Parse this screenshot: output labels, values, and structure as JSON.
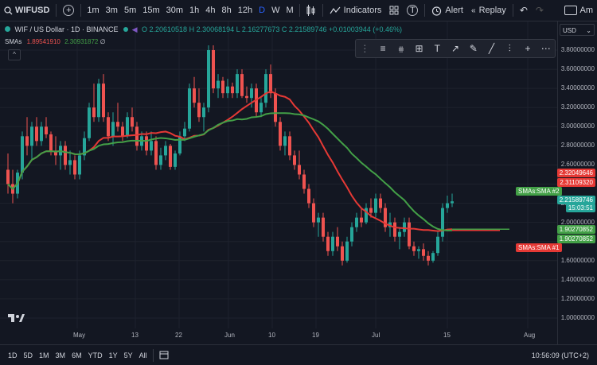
{
  "topbar": {
    "symbol": "WIFUSD",
    "add_symbol": "+",
    "timeframes": [
      "1m",
      "3m",
      "5m",
      "15m",
      "30m",
      "1h",
      "4h",
      "8h",
      "12h",
      "D",
      "W",
      "M"
    ],
    "active_timeframe": "D",
    "indicators_label": "Indicators",
    "alert_label": "Alert",
    "replay_label": "Replay",
    "right_label": "Am"
  },
  "legend": {
    "title": "WIF / US Dollar · 1D · BINANCE",
    "open": "O 2.20610518",
    "high": "H 2.30068194",
    "low": "L 2.16277673",
    "close": "C 2.21589746",
    "change": "+0.01003944 (+0.46%)",
    "sma_name": "SMAs",
    "sma_value1": "1.89541910",
    "sma_value2": "2.30931872",
    "sma_suffix": "∅"
  },
  "price_axis": {
    "currency": "USD",
    "ticks": [
      "3.80000000",
      "3.60000000",
      "3.40000000",
      "3.20000000",
      "3.00000000",
      "2.80000000",
      "2.60000000",
      "2.40000000",
      "2.20000000",
      "2.00000000",
      "1.80000000",
      "1.60000000",
      "1.40000000",
      "1.20000000",
      "1.00000000"
    ],
    "labels": {
      "sma2_top": "2.32049646",
      "sma2_bot": "2.31109320",
      "price": "2.21589746",
      "countdown": "15:03:51",
      "sma1_top": "1.90270852",
      "sma1_bot": "1.90270852"
    },
    "sma2_tag": "SMAs:SMA #2",
    "sma1_tag": "SMAs:SMA #1"
  },
  "time_axis": [
    "May",
    "13",
    "22",
    "Jun",
    "10",
    "19",
    "Jul",
    "15",
    "Aug"
  ],
  "bottombar": {
    "ranges": [
      "1D",
      "5D",
      "1M",
      "3M",
      "6M",
      "YTD",
      "1Y",
      "5Y",
      "All"
    ],
    "clock": "10:56:09 (UTC+2)"
  },
  "colors": {
    "up": "#26a69a",
    "down": "#ef5350",
    "sma_red": "#e53935",
    "sma_green": "#43a047",
    "accent": "#2962ff"
  },
  "chart_data": {
    "type": "candlestick",
    "ylim": [
      1.0,
      3.85
    ],
    "series": [
      {
        "name": "WIF",
        "ohlc": [
          [
            2.55,
            2.72,
            2.3,
            2.4
          ],
          [
            2.4,
            2.55,
            2.2,
            2.3
          ],
          [
            2.3,
            2.55,
            2.25,
            2.52
          ],
          [
            2.52,
            2.95,
            2.45,
            2.9
          ],
          [
            2.9,
            3.1,
            2.7,
            2.8
          ],
          [
            2.8,
            3.05,
            2.65,
            3.0
          ],
          [
            3.0,
            3.1,
            2.8,
            2.85
          ],
          [
            2.85,
            3.05,
            2.8,
            3.0
          ],
          [
            3.0,
            3.1,
            2.88,
            2.92
          ],
          [
            2.92,
            2.95,
            2.7,
            2.75
          ],
          [
            2.75,
            2.9,
            2.6,
            2.7
          ],
          [
            2.7,
            2.85,
            2.55,
            2.8
          ],
          [
            2.8,
            2.85,
            2.55,
            2.6
          ],
          [
            2.6,
            2.75,
            2.5,
            2.65
          ],
          [
            2.65,
            2.7,
            2.45,
            2.5
          ],
          [
            2.5,
            2.75,
            2.45,
            2.7
          ],
          [
            2.7,
            2.95,
            2.65,
            2.88
          ],
          [
            2.88,
            3.25,
            2.85,
            3.2
          ],
          [
            3.2,
            3.45,
            3.05,
            3.1
          ],
          [
            3.1,
            3.5,
            3.05,
            3.45
          ],
          [
            3.45,
            3.55,
            3.05,
            3.1
          ],
          [
            3.1,
            3.15,
            2.85,
            2.9
          ],
          [
            2.9,
            3.15,
            2.8,
            3.05
          ],
          [
            3.05,
            3.25,
            2.95,
            3.0
          ],
          [
            3.0,
            3.05,
            2.85,
            2.9
          ],
          [
            2.9,
            3.15,
            2.88,
            3.1
          ],
          [
            3.1,
            3.2,
            2.95,
            3.0
          ],
          [
            3.0,
            3.05,
            2.75,
            2.8
          ],
          [
            2.8,
            2.95,
            2.75,
            2.9
          ],
          [
            2.9,
            2.95,
            2.7,
            2.75
          ],
          [
            2.75,
            2.95,
            2.7,
            2.85
          ],
          [
            2.85,
            2.9,
            2.55,
            2.6
          ],
          [
            2.6,
            2.78,
            2.55,
            2.7
          ],
          [
            2.7,
            2.85,
            2.65,
            2.8
          ],
          [
            2.8,
            2.82,
            2.55,
            2.58
          ],
          [
            2.58,
            2.75,
            2.55,
            2.72
          ],
          [
            2.72,
            2.95,
            2.7,
            2.9
          ],
          [
            2.9,
            3.05,
            2.85,
            2.98
          ],
          [
            2.98,
            3.45,
            2.95,
            3.4
          ],
          [
            3.4,
            3.52,
            3.2,
            3.25
          ],
          [
            3.25,
            3.4,
            3.05,
            3.1
          ],
          [
            3.1,
            3.25,
            2.95,
            3.2
          ],
          [
            3.2,
            3.85,
            3.15,
            3.8
          ],
          [
            3.8,
            3.85,
            3.35,
            3.4
          ],
          [
            3.4,
            3.55,
            3.3,
            3.48
          ],
          [
            3.48,
            3.52,
            3.3,
            3.35
          ],
          [
            3.35,
            3.5,
            3.3,
            3.42
          ],
          [
            3.42,
            3.46,
            3.3,
            3.35
          ],
          [
            3.35,
            3.6,
            3.3,
            3.55
          ],
          [
            3.55,
            3.6,
            3.3,
            3.32
          ],
          [
            3.32,
            3.42,
            3.25,
            3.3
          ],
          [
            3.3,
            3.45,
            3.2,
            3.4
          ],
          [
            3.4,
            3.45,
            3.1,
            3.15
          ],
          [
            3.15,
            3.3,
            3.1,
            3.25
          ],
          [
            3.25,
            3.6,
            3.2,
            3.55
          ],
          [
            3.55,
            3.65,
            3.3,
            3.35
          ],
          [
            3.35,
            3.4,
            3.0,
            3.05
          ],
          [
            3.05,
            3.1,
            2.75,
            2.8
          ],
          [
            2.8,
            2.95,
            2.7,
            2.9
          ],
          [
            2.9,
            2.95,
            2.65,
            2.7
          ],
          [
            2.7,
            2.75,
            2.55,
            2.6
          ],
          [
            2.6,
            2.75,
            2.45,
            2.5
          ],
          [
            2.5,
            2.55,
            2.3,
            2.35
          ],
          [
            2.35,
            2.4,
            2.15,
            2.2
          ],
          [
            2.2,
            2.25,
            1.95,
            2.0
          ],
          [
            2.0,
            2.1,
            1.85,
            2.05
          ],
          [
            2.05,
            2.1,
            1.8,
            1.85
          ],
          [
            1.85,
            1.9,
            1.65,
            1.7
          ],
          [
            1.7,
            1.9,
            1.65,
            1.85
          ],
          [
            1.85,
            1.95,
            1.7,
            1.75
          ],
          [
            1.75,
            1.8,
            1.55,
            1.6
          ],
          [
            1.6,
            1.85,
            1.58,
            1.8
          ],
          [
            1.8,
            2.0,
            1.75,
            1.95
          ],
          [
            1.95,
            2.1,
            1.9,
            2.05
          ],
          [
            2.05,
            2.15,
            1.95,
            2.0
          ],
          [
            2.0,
            2.2,
            1.98,
            2.15
          ],
          [
            2.15,
            2.25,
            2.05,
            2.1
          ],
          [
            2.1,
            2.3,
            2.05,
            2.25
          ],
          [
            2.25,
            2.3,
            2.1,
            2.15
          ],
          [
            2.15,
            2.2,
            1.9,
            1.95
          ],
          [
            1.95,
            2.1,
            1.85,
            2.0
          ],
          [
            2.0,
            2.05,
            1.8,
            1.85
          ],
          [
            1.85,
            1.95,
            1.72,
            1.9
          ],
          [
            1.9,
            2.05,
            1.85,
            2.0
          ],
          [
            2.0,
            2.05,
            1.72,
            1.75
          ],
          [
            1.75,
            1.8,
            1.65,
            1.7
          ],
          [
            1.7,
            1.75,
            1.62,
            1.72
          ],
          [
            1.72,
            1.78,
            1.6,
            1.65
          ],
          [
            1.65,
            1.7,
            1.55,
            1.6
          ],
          [
            1.6,
            1.7,
            1.58,
            1.68
          ],
          [
            1.68,
            1.9,
            1.65,
            1.85
          ],
          [
            1.85,
            2.2,
            1.8,
            2.15
          ],
          [
            2.15,
            2.28,
            2.1,
            2.2
          ],
          [
            2.2,
            2.3,
            2.16,
            2.22
          ]
        ]
      },
      {
        "name": "SMA #1",
        "color": "#e53935"
      },
      {
        "name": "SMA #2",
        "color": "#43a047"
      }
    ]
  }
}
